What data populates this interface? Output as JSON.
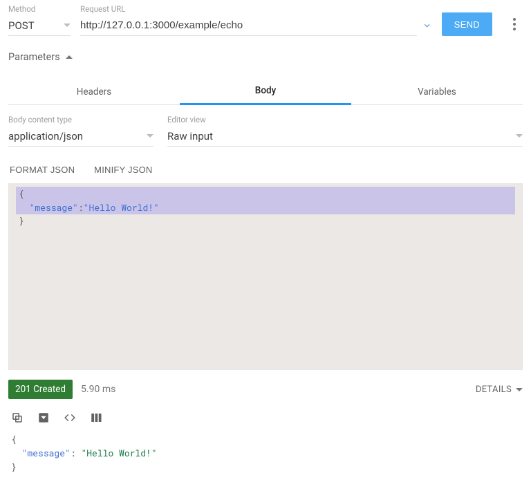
{
  "method": {
    "label": "Method",
    "value": "POST"
  },
  "url": {
    "label": "Request URL",
    "value": "http://127.0.0.1:3000/example/echo"
  },
  "send_label": "SEND",
  "parameters": {
    "label": "Parameters"
  },
  "tabs": {
    "headers": "Headers",
    "body": "Body",
    "variables": "Variables",
    "active": "body"
  },
  "content_type": {
    "label": "Body content type",
    "value": "application/json"
  },
  "editor_view": {
    "label": "Editor view",
    "value": "Raw input"
  },
  "format_btn": "FORMAT JSON",
  "minify_btn": "MINIFY JSON",
  "request_body": {
    "line1": "{",
    "line2_key": "\"message\"",
    "line2_sep": ":",
    "line2_val": "\"Hello World!\"",
    "line3": "}"
  },
  "status": {
    "badge": "201 Created",
    "time": "5.90 ms",
    "details": "DETAILS"
  },
  "response_body": {
    "line1": "{",
    "line2_key": "\"message\"",
    "line2_sep": ": ",
    "line2_val": "\"Hello World!\"",
    "line3": "}"
  }
}
